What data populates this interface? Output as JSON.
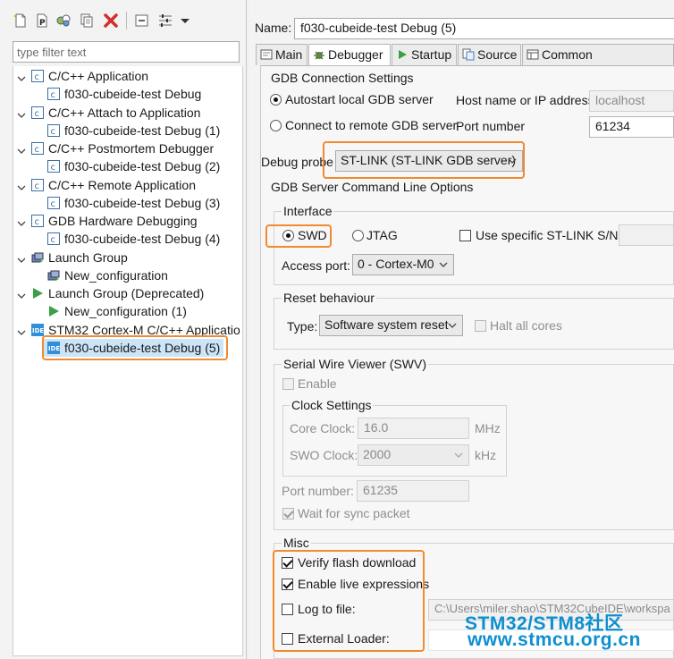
{
  "left": {
    "toolbar": {
      "icons": [
        "new-configuration-icon",
        "new-prototype-icon",
        "export-icon",
        "duplicate-icon",
        "delete-icon",
        "collapse-all-icon",
        "filter-icon",
        "view-menu-icon"
      ]
    },
    "filter_placeholder": "type filter text",
    "tree": [
      {
        "label": "C/C++ Application",
        "children": [
          "f030-cubeide-test Debug"
        ]
      },
      {
        "label": "C/C++ Attach to Application",
        "children": [
          "f030-cubeide-test Debug (1)"
        ]
      },
      {
        "label": "C/C++ Postmortem Debugger",
        "children": [
          "f030-cubeide-test Debug (2)"
        ]
      },
      {
        "label": "C/C++ Remote Application",
        "children": [
          "f030-cubeide-test Debug (3)"
        ]
      },
      {
        "label": "GDB Hardware Debugging",
        "children": [
          "f030-cubeide-test Debug (4)"
        ]
      },
      {
        "label": "Launch Group",
        "children": [
          "New_configuration"
        ]
      },
      {
        "label": "Launch Group (Deprecated)",
        "children": [
          "New_configuration (1)"
        ]
      },
      {
        "label": "STM32 Cortex-M C/C++ Applicatio",
        "children": [
          "f030-cubeide-test Debug (5)"
        ]
      }
    ]
  },
  "name_label": "Name:",
  "name_value": "f030-cubeide-test Debug (5)",
  "tabs": [
    "Main",
    "Debugger",
    "Startup",
    "Source",
    "Common"
  ],
  "selected_tab": "Debugger",
  "gdb": {
    "section_title": "GDB Connection Settings",
    "autostart_label": "Autostart local GDB server",
    "remote_label": "Connect to remote GDB server",
    "host_label": "Host name or IP address",
    "host_value": "localhost",
    "port_label": "Port number",
    "port_value": "61234"
  },
  "probe": {
    "label": "Debug probe",
    "value": "ST-LINK (ST-LINK GDB server)"
  },
  "server_options_title": "GDB Server Command Line Options",
  "interface": {
    "title": "Interface",
    "swd": "SWD",
    "jtag": "JTAG",
    "specific_sn": "Use specific ST-LINK S/N",
    "access_port_label": "Access port:",
    "access_port_value": "0 - Cortex-M0"
  },
  "reset": {
    "title": "Reset behaviour",
    "type_label": "Type:",
    "type_value": "Software system reset",
    "halt_label": "Halt all cores"
  },
  "swv": {
    "title": "Serial Wire Viewer (SWV)",
    "enable_label": "Enable",
    "clock_title": "Clock Settings",
    "core_clock_label": "Core Clock:",
    "core_clock_value": "16.0",
    "core_clock_unit": "MHz",
    "swo_clock_label": "SWO Clock:",
    "swo_clock_value": "2000",
    "swo_clock_unit": "kHz",
    "port_label": "Port number:",
    "port_value": "61235",
    "wait_label": "Wait for sync packet"
  },
  "misc": {
    "title": "Misc",
    "verify_label": "Verify flash download",
    "live_label": "Enable live expressions",
    "log_label": "Log to file:",
    "log_path": "C:\\Users\\miler.shao\\STM32CubeIDE\\workspa",
    "loader_label": "External Loader:"
  },
  "watermark": {
    "line1": "STM32/STM8社区",
    "line2": "www.stmcu.org.cn"
  },
  "colors": {
    "highlight_orange": "#f28a2e",
    "selection_blue": "#cce4f7",
    "watermark_blue": "#0d8fd0"
  }
}
